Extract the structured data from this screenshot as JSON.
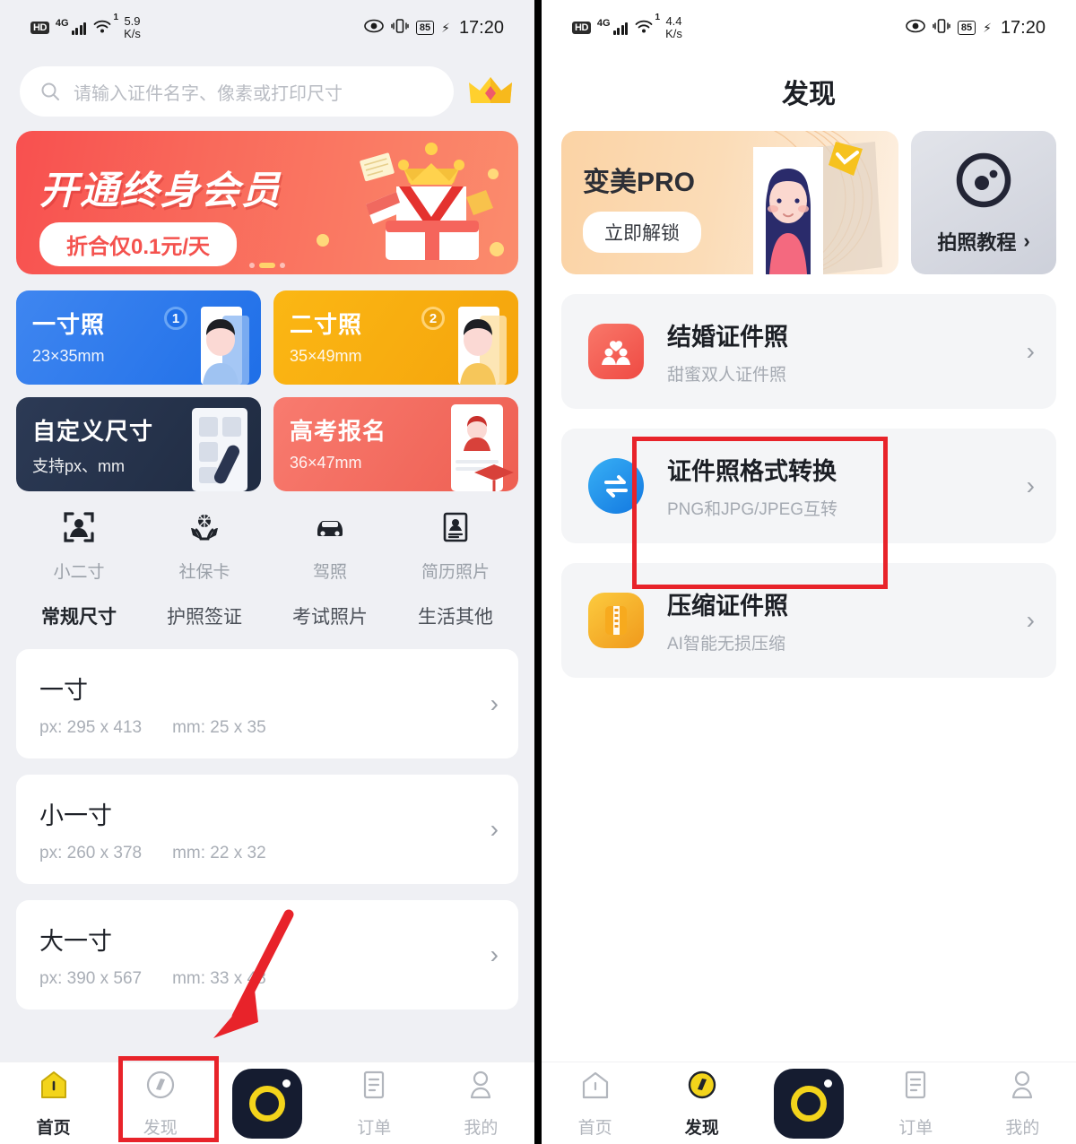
{
  "left": {
    "status": {
      "hd": "HD",
      "network": "4G",
      "wifi_sup": "1",
      "speed_value": "5.9",
      "speed_unit": "K/s",
      "battery": "85",
      "clock": "17:20"
    },
    "search": {
      "placeholder": "请输入证件名字、像素或打印尺寸",
      "icon": "search-icon",
      "vip_icon": "crown-icon"
    },
    "banner": {
      "title": "开通终身会员",
      "pill": "折合仅0.1元/天"
    },
    "cards": [
      {
        "title": "一寸照",
        "sub": "23×35mm",
        "badge": "1"
      },
      {
        "title": "二寸照",
        "sub": "35×49mm",
        "badge": "2"
      },
      {
        "title": "自定义尺寸",
        "sub": "支持px、mm",
        "badge": ""
      },
      {
        "title": "高考报名",
        "sub": "36×47mm",
        "badge": ""
      }
    ],
    "quick": [
      {
        "label": "小二寸",
        "icon": "portrait-frame-icon"
      },
      {
        "label": "社保卡",
        "icon": "hands-care-icon"
      },
      {
        "label": "驾照",
        "icon": "car-icon"
      },
      {
        "label": "简历照片",
        "icon": "id-card-icon"
      }
    ],
    "tabs": [
      {
        "label": "常规尺寸",
        "active": true
      },
      {
        "label": "护照签证",
        "active": false
      },
      {
        "label": "考试照片",
        "active": false
      },
      {
        "label": "生活其他",
        "active": false
      }
    ],
    "sizes": [
      {
        "name": "一寸",
        "px": "px: 295 x 413",
        "mm": "mm: 25 x 35"
      },
      {
        "name": "小一寸",
        "px": "px: 260 x 378",
        "mm": "mm: 22 x 32"
      },
      {
        "name": "大一寸",
        "px": "px: 390 x 567",
        "mm": "mm: 33 x 48"
      }
    ],
    "nav": [
      {
        "label": "首页",
        "icon": "home-icon",
        "active": true
      },
      {
        "label": "发现",
        "icon": "compass-icon",
        "active": false
      },
      {
        "label": "",
        "icon": "camera-shutter-icon",
        "active": false
      },
      {
        "label": "订单",
        "icon": "order-list-icon",
        "active": false
      },
      {
        "label": "我的",
        "icon": "person-icon",
        "active": false
      }
    ]
  },
  "right": {
    "status": {
      "hd": "HD",
      "network": "4G",
      "wifi_sup": "1",
      "speed_value": "4.4",
      "speed_unit": "K/s",
      "battery": "85",
      "clock": "17:20"
    },
    "page_title": "发现",
    "pro_card": {
      "title": "变美PRO",
      "button": "立即解锁"
    },
    "tutorial_card": {
      "label": "拍照教程",
      "chevron": "›",
      "icon": "camera-lens-icon"
    },
    "items": [
      {
        "title": "结婚证件照",
        "sub": "甜蜜双人证件照",
        "icon": "couple-icon",
        "color": "#f2584e"
      },
      {
        "title": "证件照格式转换",
        "sub": "PNG和JPG/JPEG互转",
        "icon": "swap-arrows-icon",
        "color": "#2196f3"
      },
      {
        "title": "压缩证件照",
        "sub": "AI智能无损压缩",
        "icon": "zip-file-icon",
        "color": "#f5a623"
      }
    ],
    "nav": [
      {
        "label": "首页",
        "icon": "home-icon",
        "active": false
      },
      {
        "label": "发现",
        "icon": "compass-icon",
        "active": true
      },
      {
        "label": "",
        "icon": "camera-shutter-icon",
        "active": false
      },
      {
        "label": "订单",
        "icon": "order-list-icon",
        "active": false
      },
      {
        "label": "我的",
        "icon": "person-icon",
        "active": false
      }
    ]
  },
  "annotations": {
    "highlight_color": "#e8232a",
    "boxes": [
      {
        "name": "discover-tab-highlight"
      },
      {
        "name": "format-convert-highlight"
      }
    ],
    "arrow": {
      "name": "pointer-arrow"
    }
  }
}
